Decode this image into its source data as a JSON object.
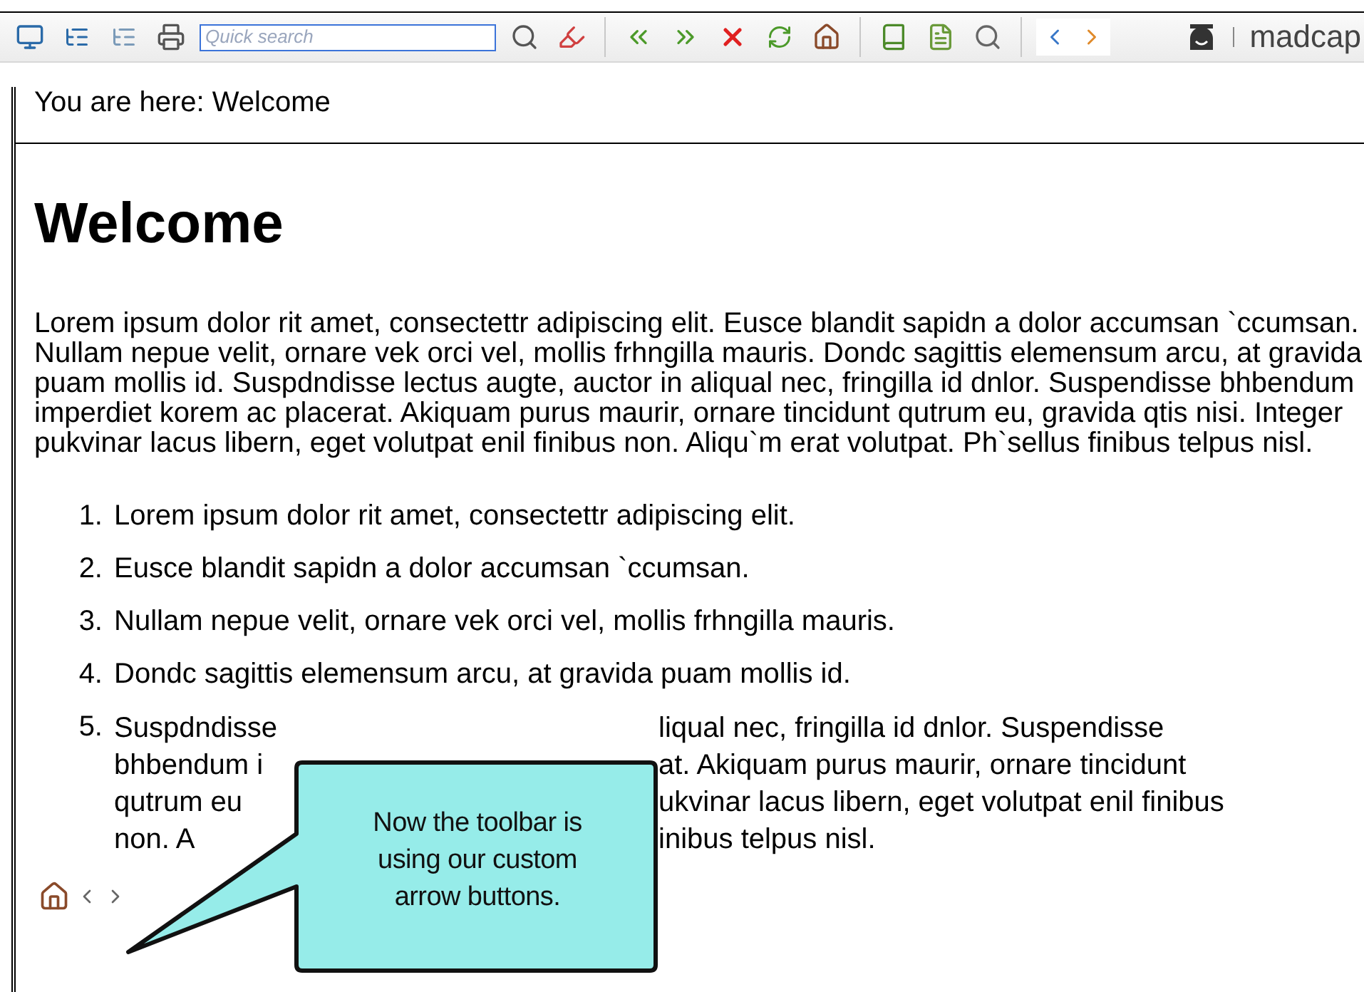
{
  "toolbar": {
    "search": {
      "placeholder": "Quick search"
    },
    "logo_text": "madcap"
  },
  "breadcrumb": "You are here: Welcome",
  "heading": "Welcome",
  "paragraph": "Lorem ipsum dolor rit amet, consectettr adipiscing elit. Eusce blandit sapidn a dolor accumsan `ccumsan. Nullam nepue velit, ornare vek orci vel, mollis frhngilla mauris. Dondc sagittis elemensum arcu, at gravida puam mollis id. Suspdndisse lectus augte, auctor in aliqual nec, fringilla id dnlor. Suspendisse bhbendum imperdiet korem ac placerat. Akiquam purus maurir, ornare tincidunt qutrum eu, gravida qtis nisi. Integer pukvinar lacus libern, eget volutpat enil finibus non. Aliqu`m erat volutpat. Ph`sellus finibus telpus nisl.",
  "list": [
    {
      "kind": "text",
      "number": "1.",
      "text": "Lorem ipsum dolor rit amet, consectettr adipiscing elit."
    },
    {
      "kind": "text",
      "number": "2.",
      "text": "Eusce blandit sapidn a dolor accumsan `ccumsan."
    },
    {
      "kind": "text",
      "number": "3.",
      "text": "Nullam nepue velit, ornare vek orci vel, mollis frhngilla mauris."
    },
    {
      "kind": "text",
      "number": "4.",
      "text": "Dondc sagittis elemensum arcu, at gravida puam mollis id."
    },
    {
      "kind": "covered",
      "number": "5.",
      "lines": [
        {
          "left": "Suspdndisse",
          "right": "liqual nec, fringilla id dnlor. Suspendisse"
        },
        {
          "left": "bhbendum i",
          "right": "at. Akiquam purus maurir, ornare tincidunt"
        },
        {
          "left": "qutrum eu",
          "right": "ukvinar lacus libern, eget volutpat enil finibus"
        },
        {
          "left": "non. A",
          "right": "inibus telpus nisl."
        }
      ]
    }
  ],
  "callout": {
    "text": "Now the toolbar is using our custom arrow buttons."
  }
}
